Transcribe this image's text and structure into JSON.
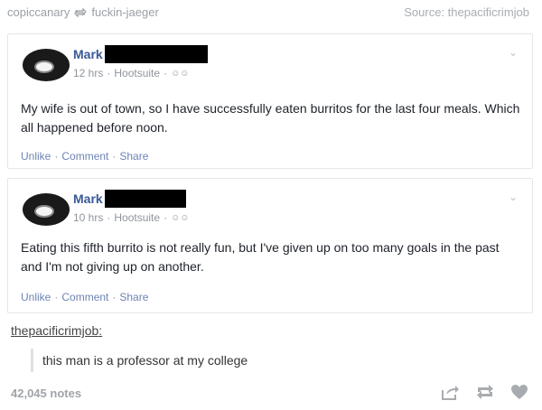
{
  "header": {
    "reblogged_from": "copiccanary",
    "original_poster": "fuckin-jaeger",
    "source": "Source: thepacificrimjob"
  },
  "posts": [
    {
      "author": "Mark",
      "time": "12 hrs",
      "via": "Hootsuite",
      "text": "My wife is out of town, so I have successfully eaten burritos for the last four meals. Which all happened before noon.",
      "actions": {
        "unlike": "Unlike",
        "comment": "Comment",
        "share": "Share"
      }
    },
    {
      "author": "Mark",
      "time": "10 hrs",
      "via": "Hootsuite",
      "text": "Eating this fifth burrito is not really fun, but I've given up on too many goals in the past and I'm not giving up on another.",
      "actions": {
        "unlike": "Unlike",
        "comment": "Comment",
        "share": "Share"
      }
    }
  ],
  "reblog": {
    "user": "thepacificrimjob",
    "comment": "this man is a professor at my college"
  },
  "footer": {
    "notes": "42,045 notes",
    "icons": [
      "share-icon",
      "reblog-icon",
      "like-heart-icon"
    ]
  },
  "colors": {
    "facebook_link": "#3b5998",
    "action_link": "#6d84b4",
    "muted": "#90949c"
  }
}
